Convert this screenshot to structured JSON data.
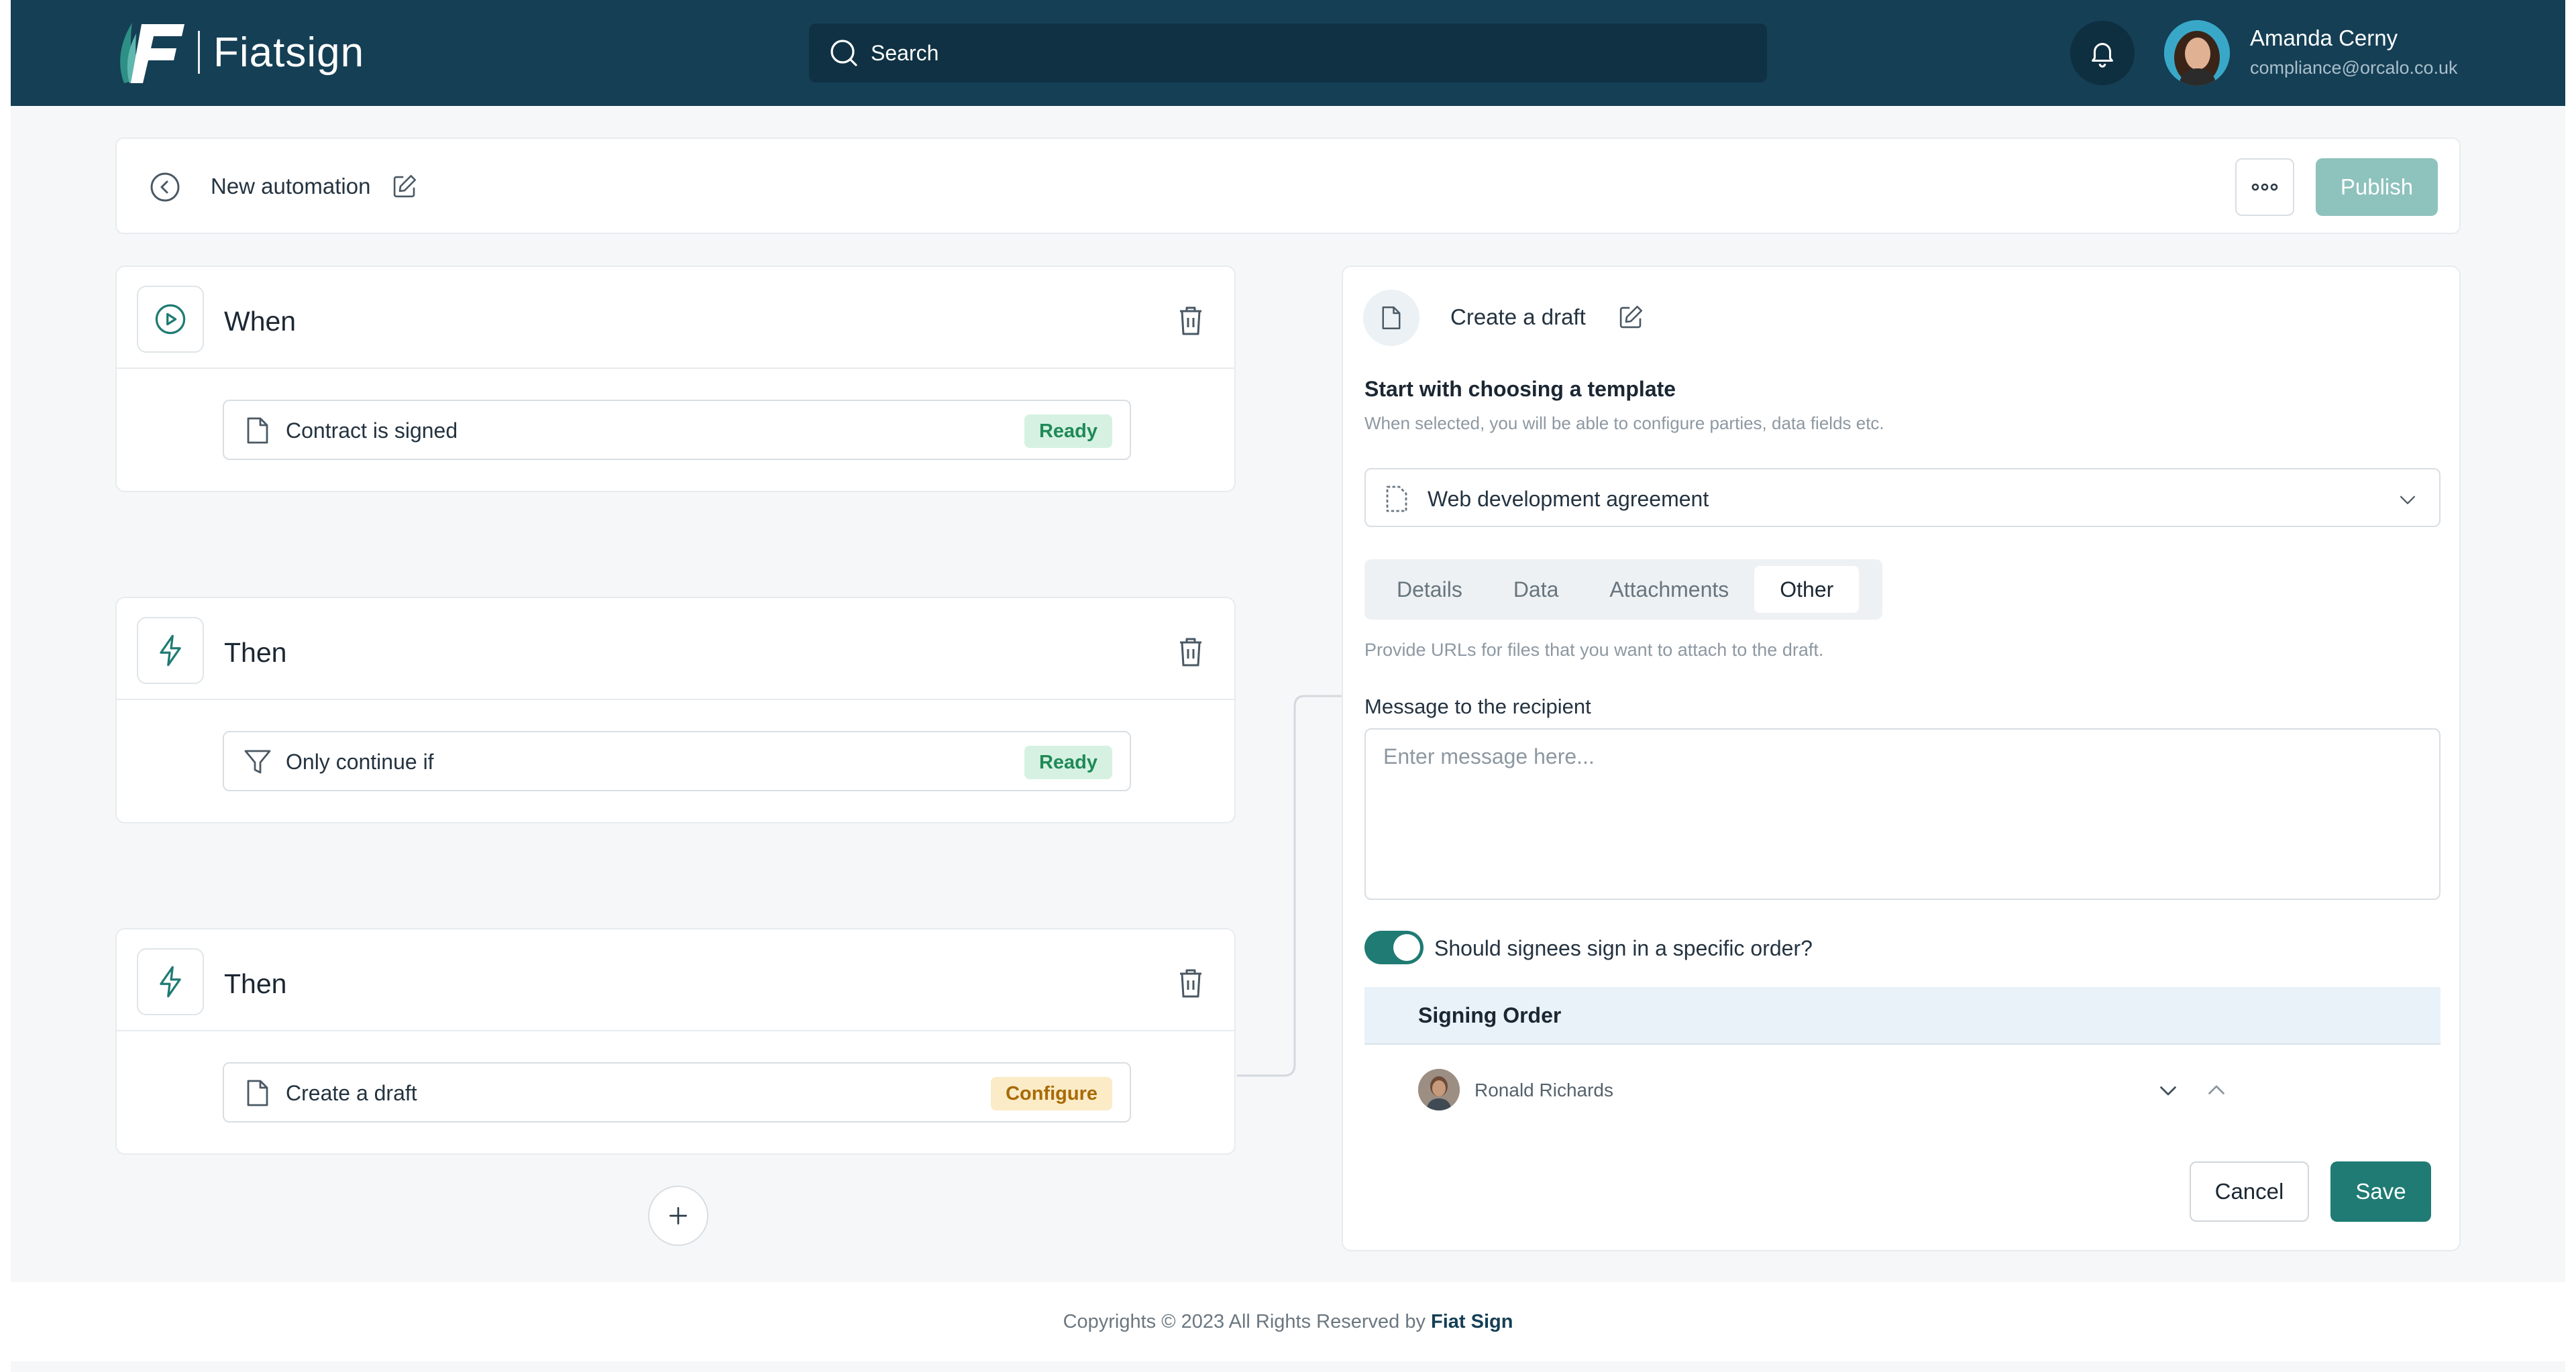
{
  "brand": {
    "name": "Fiatsign"
  },
  "search": {
    "placeholder": "Search"
  },
  "user": {
    "name": "Amanda Cerny",
    "email": "compliance@orcalo.co.uk"
  },
  "automation": {
    "title": "New automation",
    "publish_label": "Publish"
  },
  "flow": {
    "cards": [
      {
        "title": "When",
        "icon": "play-circle-icon",
        "step": {
          "label": "Contract is signed",
          "icon": "document-icon",
          "status": "Ready"
        }
      },
      {
        "title": "Then",
        "icon": "lightning-icon",
        "step": {
          "label": "Only continue if",
          "icon": "filter-icon",
          "status": "Ready"
        }
      },
      {
        "title": "Then",
        "icon": "lightning-icon",
        "step": {
          "label": "Create a draft",
          "icon": "document-icon",
          "status": "Configure"
        }
      }
    ]
  },
  "panel": {
    "title": "Create a draft",
    "section_title": "Start with choosing a template",
    "section_sub": "When selected, you will be able to configure parties, data fields etc.",
    "template_value": "Web development agreement",
    "tabs": [
      "Details",
      "Data",
      "Attachments",
      "Other"
    ],
    "active_tab": "Other",
    "hint": "Provide URLs for files that you want to attach to the draft.",
    "message_label": "Message to the recipient",
    "message_placeholder": "Enter message here...",
    "toggle_label": "Should signees sign in a specific order?",
    "signing_order_title": "Signing Order",
    "signee_name": "Ronald Richards",
    "cancel_label": "Cancel",
    "save_label": "Save"
  },
  "footer": {
    "text": "Copyrights © 2023 All Rights Reserved by",
    "brand": "Fiat Sign"
  },
  "colors": {
    "header_bg": "#153f55",
    "accent": "#1f7b73",
    "ready": "#1f8a57",
    "configure": "#a86a05"
  }
}
